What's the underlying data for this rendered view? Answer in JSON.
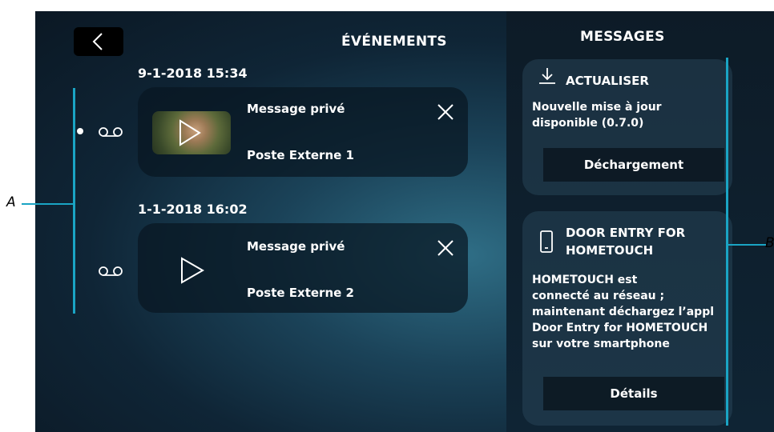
{
  "header": {
    "events_title": "ÉVÉNEMENTS",
    "messages_title": "MESSAGES"
  },
  "events": [
    {
      "date": "9-1-2018  15:34",
      "title": "Message privé",
      "source": "Poste Externe 1",
      "unread": true,
      "has_thumbnail": true
    },
    {
      "date": "1-1-2018  16:02",
      "title": "Message privé",
      "source": "Poste Externe 2",
      "unread": false,
      "has_thumbnail": false
    }
  ],
  "messages": [
    {
      "icon": "download-icon",
      "heading": "ACTUALISER",
      "body_lines": [
        "Nouvelle mise à jour",
        "disponible (0.7.0)"
      ],
      "button": "Déchargement"
    },
    {
      "icon": "smartphone-icon",
      "heading_lines": [
        "DOOR ENTRY FOR",
        "HOMETOUCH"
      ],
      "body_lines": [
        "HOMETOUCH est",
        "connecté au réseau ;",
        "maintenant déchargez l’appl",
        "Door Entry for HOMETOUCH",
        "sur votre smartphone"
      ],
      "button": "Détails"
    }
  ],
  "annotations": {
    "a": "A",
    "b": "B"
  },
  "colors": {
    "annotation_line": "#1aa4c4",
    "card_bg": "#0a1621",
    "panel_bg": "#0d1b27"
  }
}
